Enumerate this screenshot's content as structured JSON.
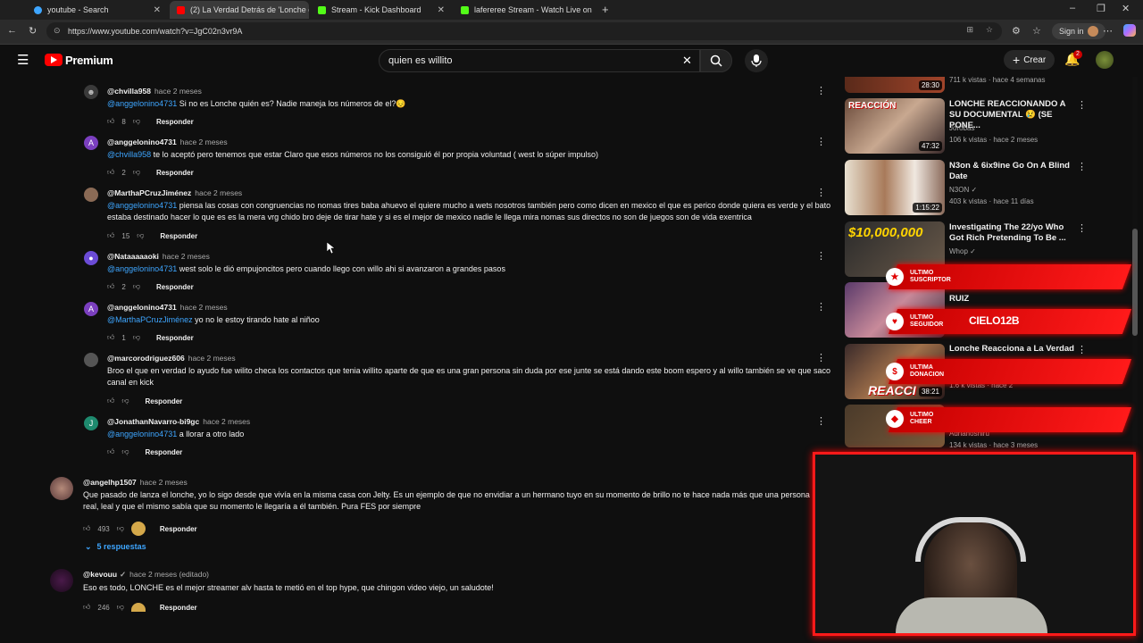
{
  "browser": {
    "tabs": [
      {
        "title": "youtube - Search"
      },
      {
        "title": "(2) La Verdad Detrás de 'Lonche c"
      },
      {
        "title": "Stream - Kick Dashboard"
      },
      {
        "title": "lafereree Stream - Watch Live on"
      }
    ],
    "url": "https://www.youtube.com/watch?v=JgC02n3vr9A",
    "signin_label": "Sign in"
  },
  "youtube": {
    "brand": "Premium",
    "search_value": "quien es willito",
    "create_label": "Crear",
    "notification_count": "2"
  },
  "comments": [
    {
      "handle": "@chvilla958",
      "time": "hace 2 meses",
      "mention": "@anggelonino4731",
      "text": " Si no es Lonche quién es? Nadie maneja los números de el?😔",
      "likes": "8",
      "reply": "Responder"
    },
    {
      "handle": "@anggelonino4731",
      "time": "hace 2 meses",
      "mention": "@chvilla958",
      "text": " te lo aceptó pero tenemos que estar Claro que esos números no los consiguió él por propia voluntad ( west lo súper impulso)",
      "likes": "2",
      "reply": "Responder"
    },
    {
      "handle": "@MarthaPCruzJiménez",
      "time": "hace 2 meses",
      "mention": "@anggelonino4731",
      "text": " piensa las cosas con congruencias no nomas tires baba ahuevo el quiere mucho a wets nosotros también pero como dicen en mexico el que es perico donde quiera es verde y el bato estaba destinado hacer lo que es es la mera vrg chido bro deje de tirar hate y si es el mejor de mexico nadie le llega mira nomas sus directos no son de juegos son de vida exentrica",
      "likes": "15",
      "reply": "Responder"
    },
    {
      "handle": "@Nataaaaaoki",
      "time": "hace 2 meses",
      "mention": "@anggelonino4731",
      "text": " west solo le dió empujoncitos pero cuando llego con willo ahi si avanzaron a grandes pasos",
      "likes": "2",
      "reply": "Responder"
    },
    {
      "handle": "@anggelonino4731",
      "time": "hace 2 meses",
      "mention": "@MarthaPCruzJiménez",
      "text": " yo no le estoy tirando hate al niñoo",
      "likes": "1",
      "reply": "Responder"
    },
    {
      "handle": "@marcorodriguez606",
      "time": "hace 2 meses",
      "mention": "",
      "text": "Broo el que en verdad lo ayudo fue wilito checa los contactos que tenia willito aparte de que es una gran persona sin duda por ese junte se está dando este boom espero y al willo también se ve que saco canal en kick",
      "likes": "",
      "reply": "Responder"
    },
    {
      "handle": "@JonathanNavarro-bi9gc",
      "time": "hace 2 meses",
      "mention": "@anggelonino4731",
      "text": " a llorar a otro lado",
      "likes": "",
      "reply": "Responder"
    }
  ],
  "top_comments": [
    {
      "handle": "@angelhp1507",
      "time": "hace 2 meses",
      "text": "Que pasado de lanza el lonche, yo lo sigo desde que vivía en la misma casa con Jelty. Es un ejemplo de que no envidiar a un hermano tuyo en su momento de brillo no te hace nada más que una persona real, leal y que el mismo sabía que su momento le llegaría a él también. Pura FES por siempre",
      "likes": "493",
      "reply": "Responder",
      "replies_label": "5 respuestas"
    },
    {
      "handle": "@kevouu",
      "time": "hace 2 meses (editado)",
      "text": "Eso es todo, LONCHE es el mejor streamer alv hasta te metió en el top hype, que chingon video viejo, un saludote!",
      "likes": "246",
      "reply": "Responder"
    }
  ],
  "sidebar": [
    {
      "title": "",
      "meta1": "",
      "meta2": "711 k vistas · hace 4 semanas",
      "duration": "28:30"
    },
    {
      "title": "LONCHE REACCIONANDO A SU DOCUMENTAL 😢 (SE PONE...",
      "meta1": "Jorobas",
      "meta2": "106 k vistas · hace 2 meses",
      "duration": "47:32",
      "thumb_text": "REACCIÓN"
    },
    {
      "title": "N3on & 6ix9ine Go On A Blind Date",
      "meta1": "N3ON ✓",
      "meta2": "403 k vistas · hace 11 días",
      "duration": "1:15:22"
    },
    {
      "title": "Investigating The 22/yo Who Got Rich Pretending To Be ...",
      "meta1": "Whop ✓",
      "meta2": "",
      "duration": "",
      "thumb_text": "$10,000,000"
    },
    {
      "title": "RUIZ",
      "meta1": "",
      "meta2": "",
      "duration": ""
    },
    {
      "title": "Lonche Reacciona a La Verdad",
      "meta1": "",
      "meta2": "1.6 k vistas · hace 2",
      "duration": "38:21",
      "thumb_text": "REACCI"
    },
    {
      "title": "",
      "meta1": "Adrianoshiru",
      "meta2": "134 k vistas · hace 3 meses",
      "duration": ""
    }
  ],
  "overlay": [
    {
      "label": "ULTIMO SUSCRIPTOR",
      "value": "",
      "icon": "star-icon"
    },
    {
      "label": "ULTIMO SEGUIDOR",
      "value": "CIELO12B",
      "icon": "heart-icon"
    },
    {
      "label": "ULTIMA DONACION",
      "value": "",
      "icon": "dollar-icon"
    },
    {
      "label": "ULTIMO CHEER",
      "value": "",
      "icon": "diamond-icon"
    }
  ],
  "colors": {
    "accent": "#ff0000",
    "link": "#3ea6ff",
    "overlay": "#ff1a1a"
  }
}
